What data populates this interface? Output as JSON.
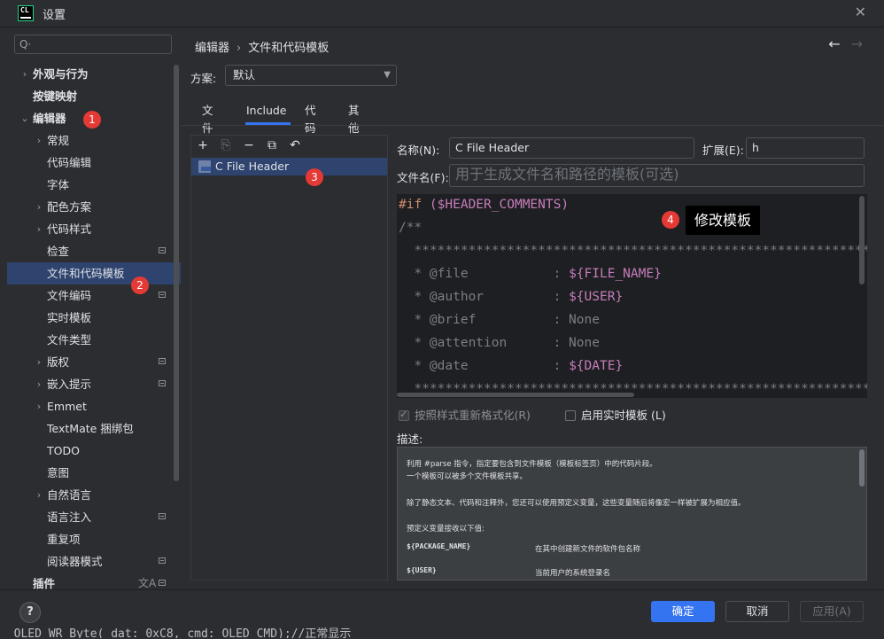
{
  "window": {
    "app_logo": "CL",
    "title": "设置"
  },
  "left": {
    "search_placeholder": "Q·",
    "tree": [
      {
        "label": "外观与行为",
        "chev": "›",
        "bold": true,
        "indent": 0
      },
      {
        "label": "按键映射",
        "chev": "",
        "bold": true,
        "indent": 0
      },
      {
        "label": "编辑器",
        "chev": "⌄",
        "bold": true,
        "indent": 0
      },
      {
        "label": "常规",
        "chev": "›",
        "indent": 1
      },
      {
        "label": "代码编辑",
        "chev": "",
        "indent": 2
      },
      {
        "label": "字体",
        "chev": "",
        "indent": 2
      },
      {
        "label": "配色方案",
        "chev": "›",
        "indent": 1
      },
      {
        "label": "代码样式",
        "chev": "›",
        "indent": 1
      },
      {
        "label": "检查",
        "chev": "",
        "indent": 2,
        "badge": true
      },
      {
        "label": "文件和代码模板",
        "chev": "",
        "indent": 2,
        "selected": true
      },
      {
        "label": "文件编码",
        "chev": "",
        "indent": 2,
        "badge": true
      },
      {
        "label": "实时模板",
        "chev": "",
        "indent": 2
      },
      {
        "label": "文件类型",
        "chev": "",
        "indent": 2
      },
      {
        "label": "版权",
        "chev": "›",
        "indent": 1,
        "badge": true
      },
      {
        "label": "嵌入提示",
        "chev": "›",
        "indent": 1,
        "badge": true
      },
      {
        "label": "Emmet",
        "chev": "›",
        "indent": 1
      },
      {
        "label": "TextMate 捆绑包",
        "chev": "",
        "indent": 2
      },
      {
        "label": "TODO",
        "chev": "",
        "indent": 2
      },
      {
        "label": "意图",
        "chev": "",
        "indent": 2
      },
      {
        "label": "自然语言",
        "chev": "›",
        "indent": 1
      },
      {
        "label": "语言注入",
        "chev": "",
        "indent": 2,
        "badge": true
      },
      {
        "label": "重复项",
        "chev": "",
        "indent": 2
      },
      {
        "label": "阅读器模式",
        "chev": "",
        "indent": 2,
        "badge": true
      },
      {
        "label": "插件",
        "chev": "",
        "bold": true,
        "indent": 0,
        "badge": true,
        "lang": "文A"
      }
    ]
  },
  "steps": [
    "1",
    "2",
    "3",
    "4"
  ],
  "breadcrumb": {
    "part1": "编辑器",
    "sep": "›",
    "part2": "文件和代码模板",
    "back": "←",
    "forward": "→"
  },
  "scheme": {
    "label": "方案:",
    "value": "默认",
    "dd": "▼"
  },
  "tabs": [
    "文件",
    "Include",
    "代码",
    "其他"
  ],
  "toolbar": {
    "add": "+",
    "copy_dis": "⎘",
    "remove": "−",
    "duplicate": "⧉",
    "reset": "↶"
  },
  "template_list": [
    {
      "name": "C File Header"
    }
  ],
  "form": {
    "name_label": "名称(N):",
    "name_value": "C File Header",
    "ext_label": "扩展(E):",
    "ext_value": "h",
    "filename_label": "文件名(F):",
    "filename_placeholder": "用于生成文件名和路径的模板(可选)"
  },
  "editor_lines": {
    "l1_kw": "#if",
    "l1_var": " ($HEADER_COMMENTS)",
    "l2": "/**",
    "l3": "  ***********************************************************************",
    "l4_a": "  * @file           : ",
    "l4_b": "${FILE_NAME}",
    "l5_a": "  * @author         : ",
    "l5_b": "${USER}",
    "l6": "  * @brief          : None",
    "l7": "  * @attention      : None",
    "l8_a": "  * @date           : ",
    "l8_b": "${DATE}",
    "l9": "  ***********************************************************************"
  },
  "tooltip": "修改模板",
  "options": {
    "reformat": "按照样式重新格式化(R)",
    "live_template": "启用实时模板 (L)"
  },
  "description": {
    "label": "描述:",
    "p1": "利用 #parse 指令，指定要包含到文件模板（模板标签页）中的代码片段。",
    "p2": "一个模板可以被多个文件模板共享。",
    "p3": "除了静态文本、代码和注释外，您还可以使用预定义变量，这些变量随后将像宏一样被扩展为相应值。",
    "p4": "预定义变量接收以下值:",
    "vars": [
      {
        "name": "${PACKAGE_NAME}",
        "desc": "在其中创建新文件的软件包名称"
      },
      {
        "name": "${USER}",
        "desc": "当前用户的系统登录名"
      }
    ]
  },
  "buttons": {
    "help": "?",
    "ok": "确定",
    "cancel": "取消",
    "apply": "应用(A)"
  },
  "bg_code": "  OLED_WR_Byte( dat: 0xC8, cmd: OLED_CMD);//正常显示"
}
